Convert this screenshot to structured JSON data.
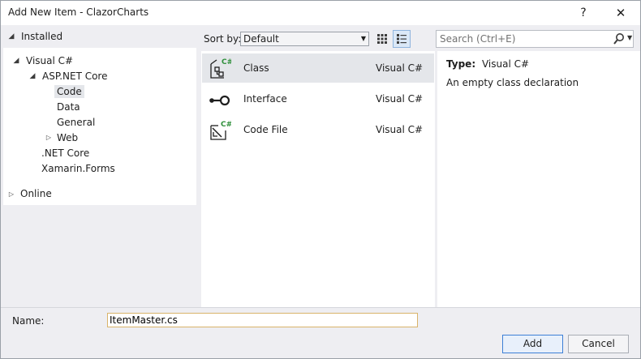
{
  "window": {
    "title": "Add New Item - ClazorCharts",
    "help_label": "?",
    "close_label": "✕"
  },
  "left": {
    "installed_label": "Installed",
    "tree": [
      {
        "label": "Visual C#",
        "level": 0,
        "expander": "open"
      },
      {
        "label": "ASP.NET Core",
        "level": 1,
        "expander": "open"
      },
      {
        "label": "Code",
        "level": 2,
        "expander": "none",
        "selected": true
      },
      {
        "label": "Data",
        "level": 2,
        "expander": "none"
      },
      {
        "label": "General",
        "level": 2,
        "expander": "none"
      },
      {
        "label": "Web",
        "level": 2,
        "expander": "closed"
      },
      {
        "label": ".NET Core",
        "level": 1,
        "expander": "none"
      },
      {
        "label": "Xamarin.Forms",
        "level": 1,
        "expander": "none"
      }
    ],
    "online_label": "Online"
  },
  "toolbar": {
    "sort_label": "Sort by:",
    "sort_value": "Default",
    "search_placeholder": "Search (Ctrl+E)"
  },
  "items": [
    {
      "name": "Class",
      "language": "Visual C#",
      "icon": "class-icon",
      "selected": true
    },
    {
      "name": "Interface",
      "language": "Visual C#",
      "icon": "interface-icon",
      "selected": false
    },
    {
      "name": "Code File",
      "language": "Visual C#",
      "icon": "code-file-icon",
      "selected": false
    }
  ],
  "detail": {
    "type_label": "Type:",
    "type_value": "Visual C#",
    "description": "An empty class declaration"
  },
  "bottom": {
    "name_label": "Name:",
    "name_value": "ItemMaster.cs",
    "add_label": "Add",
    "cancel_label": "Cancel"
  },
  "colors": {
    "accent": "#3c7fd6",
    "csharp_badge": "#2e8f3a",
    "selection": "#e4e6ea"
  }
}
